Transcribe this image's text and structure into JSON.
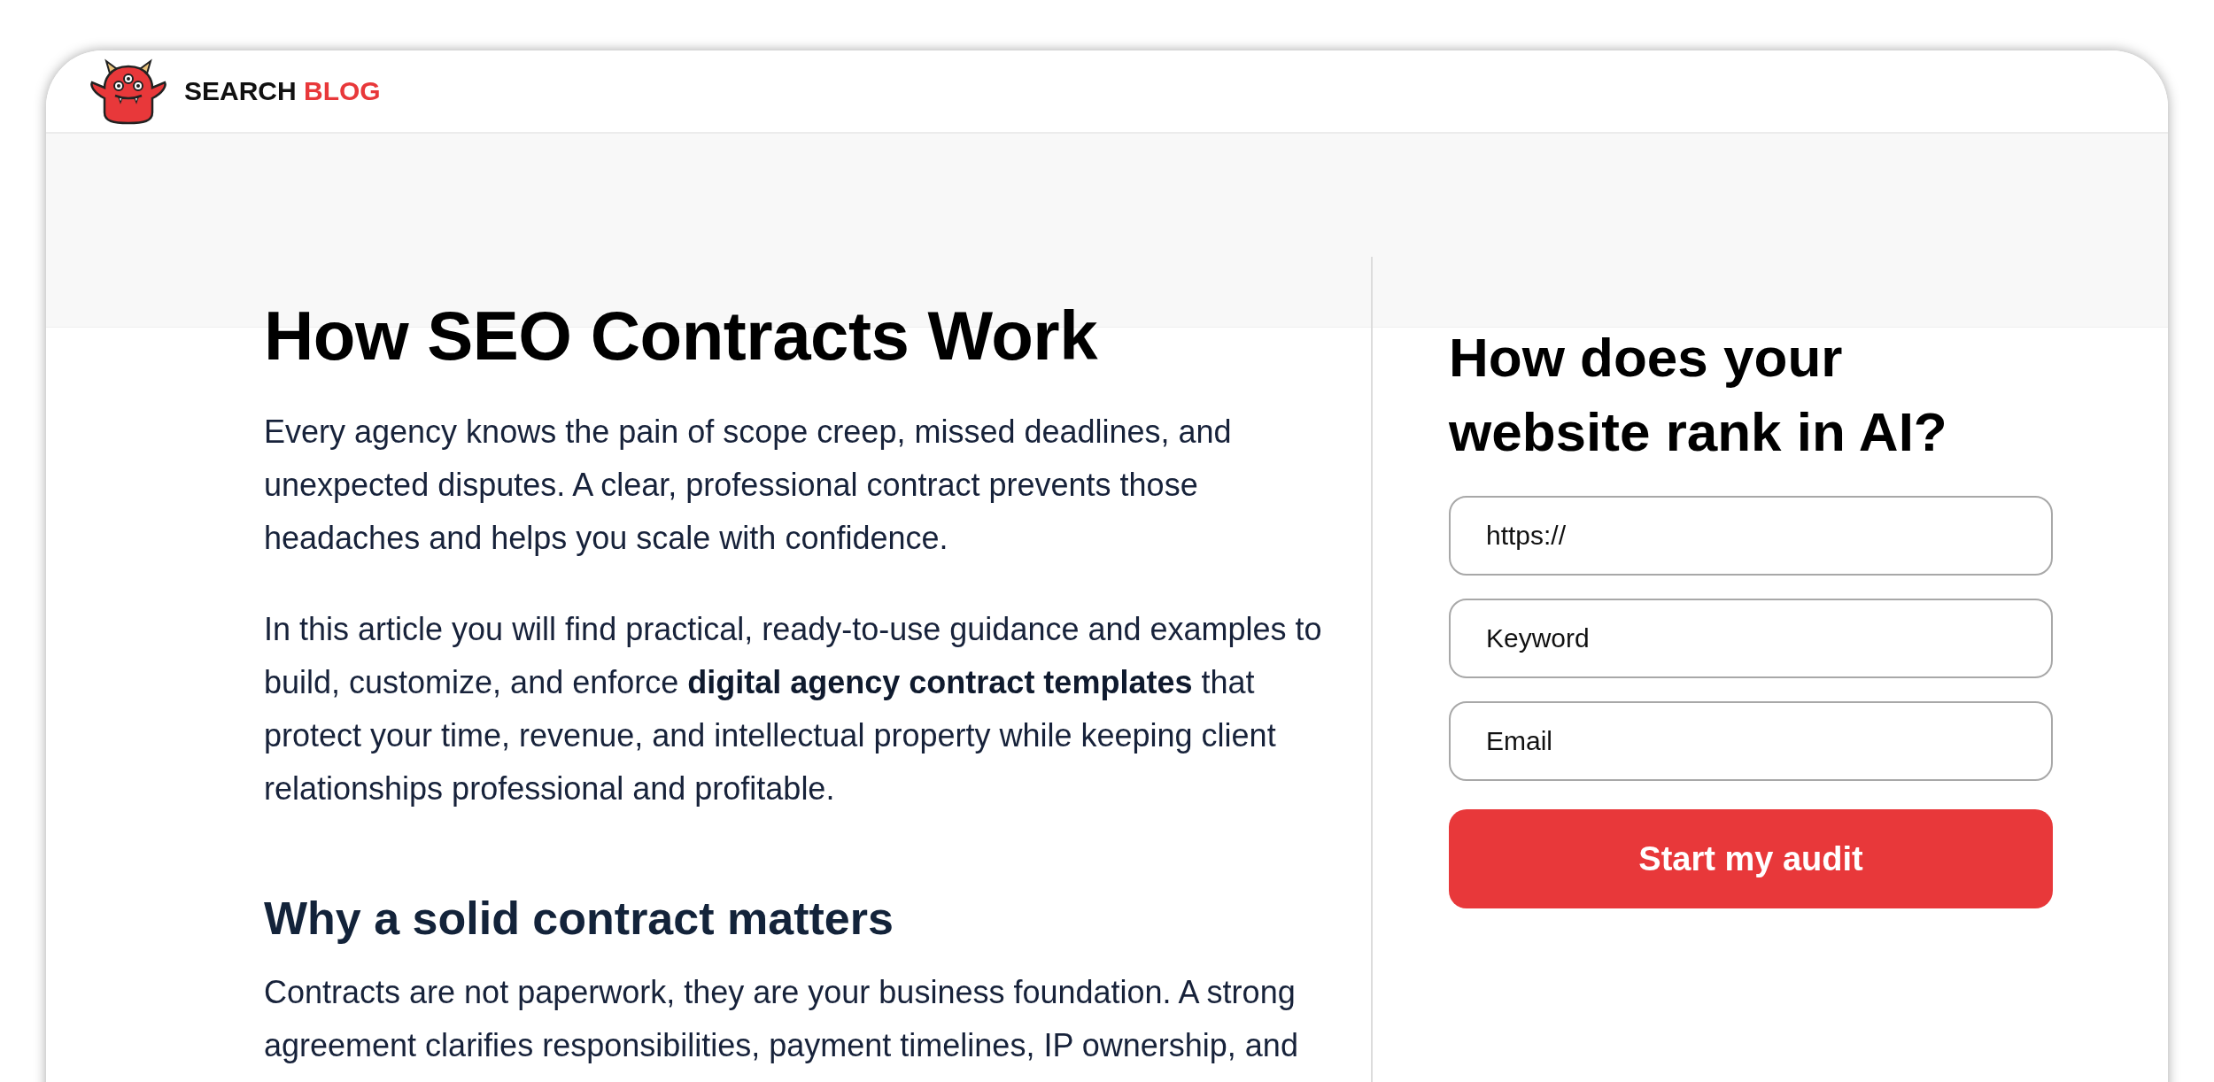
{
  "header": {
    "logo": {
      "word_1": "SEARCH",
      "word_2": "BLOG"
    }
  },
  "article": {
    "title": "How SEO Contracts Work",
    "paragraphs": [
      "Every agency knows the pain of scope creep, missed deadlines, and unexpected disputes. A clear, professional contract prevents those headaches and helps you scale with confidence.",
      "In this article you will find practical, ready-to-use guidance and examples to build, customize, and enforce **digital agency contract templates** that protect your time, revenue, and intellectual property while keeping client relationships professional and profitable."
    ],
    "sections": [
      {
        "heading": "Why a solid contract matters",
        "paragraphs": [
          "Contracts are not paperwork, they are your business foundation. A strong agreement clarifies responsibilities, payment timelines, IP ownership, and"
        ]
      }
    ]
  },
  "sidebar": {
    "heading": "How does your website rank in AI?",
    "fields": [
      {
        "placeholder": "https://"
      },
      {
        "placeholder": "Keyword"
      },
      {
        "placeholder": "Email"
      }
    ],
    "submit": "Start my audit"
  }
}
